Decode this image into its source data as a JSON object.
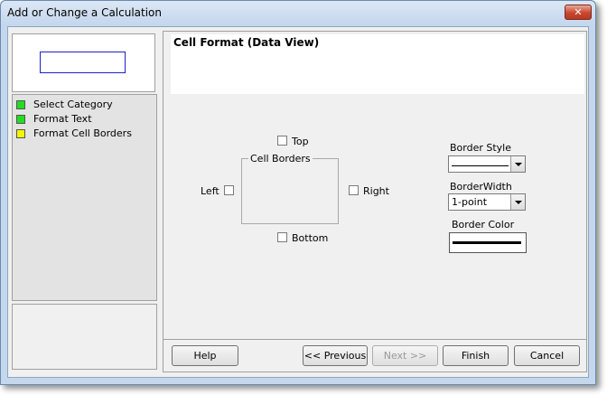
{
  "window": {
    "title": "Add or Change a Calculation",
    "close_label": "✕"
  },
  "steps": [
    {
      "label": "Select Category",
      "color": "#22dd22"
    },
    {
      "label": "Format Text",
      "color": "#22dd22"
    },
    {
      "label": "Format Cell Borders",
      "color": "#f5f500"
    }
  ],
  "header": {
    "title": "Cell Format (Data View)"
  },
  "borders": {
    "group_label": "Cell Borders",
    "top_label": "Top",
    "left_label": "Left",
    "right_label": "Right",
    "bottom_label": "Bottom"
  },
  "border_style": {
    "label": "Border Style"
  },
  "border_width": {
    "label": "BorderWidth",
    "value": "1-point"
  },
  "border_color": {
    "label": "Border Color"
  },
  "buttons": {
    "help": "Help",
    "previous": "<< Previous",
    "next": "Next >>",
    "finish": "Finish",
    "cancel": "Cancel"
  }
}
